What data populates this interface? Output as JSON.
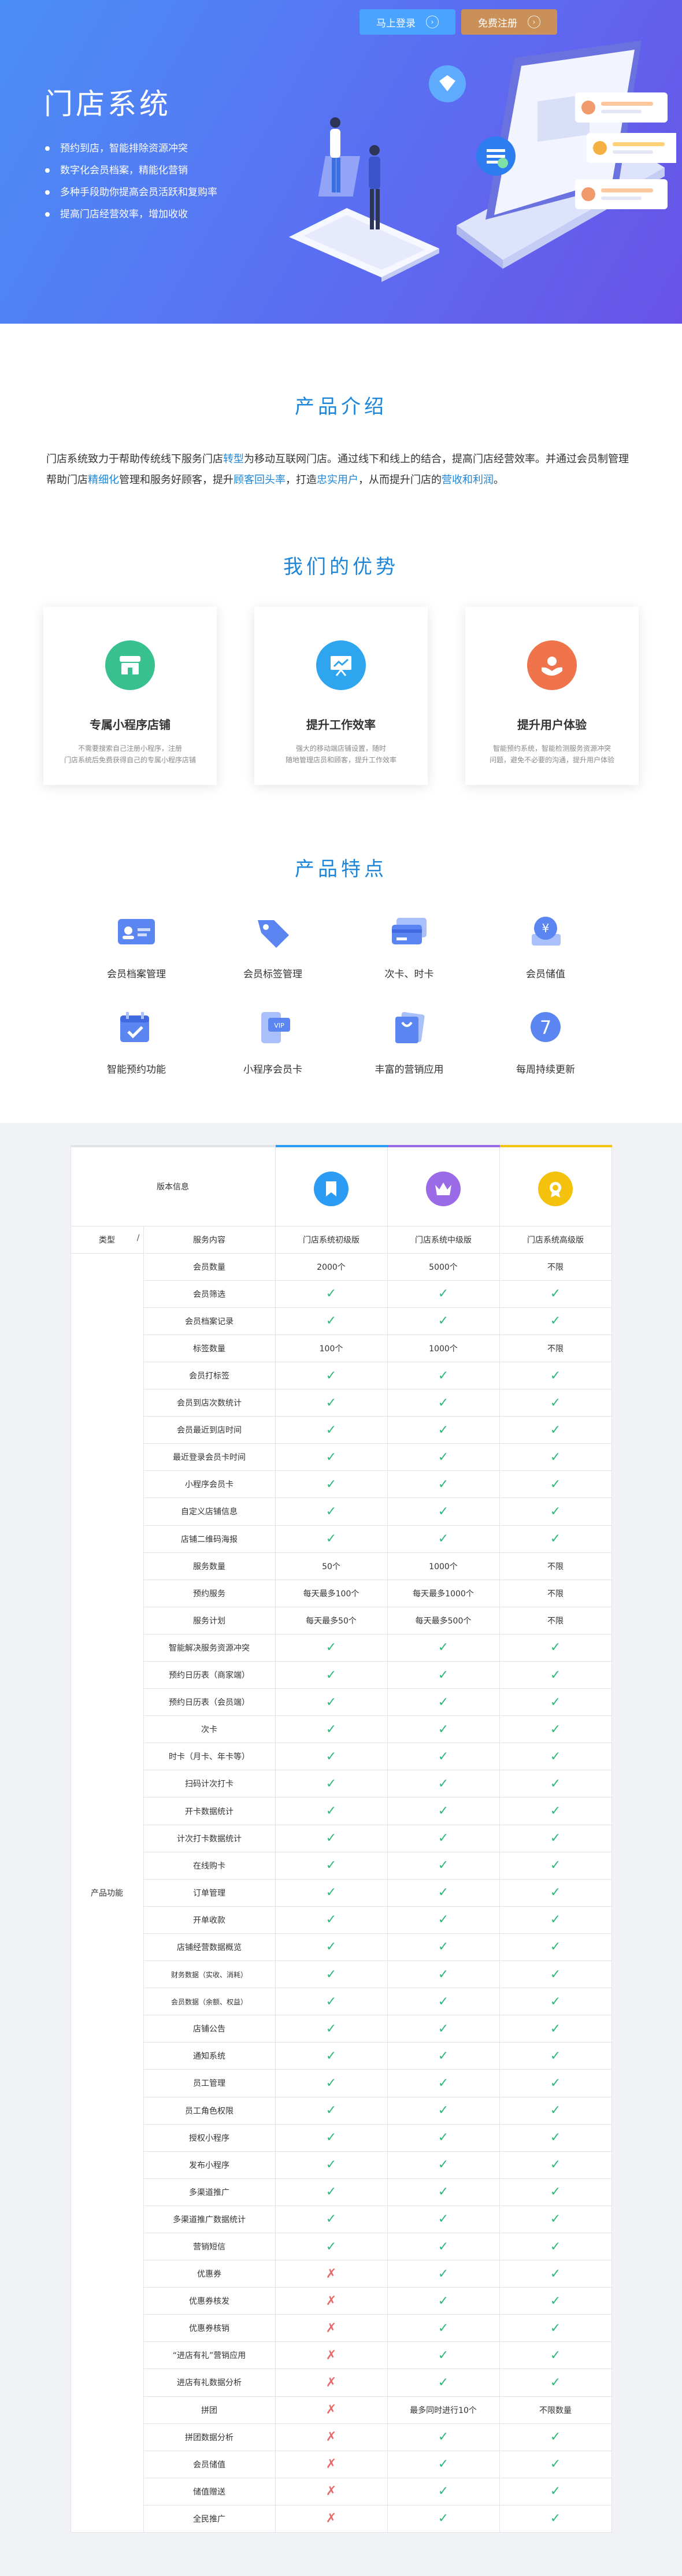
{
  "header": {
    "login_label": "马上登录",
    "register_label": "免费注册"
  },
  "hero": {
    "title": "门店系统",
    "bullets": [
      "预约到店，智能排除资源冲突",
      "数字化会员档案，精能化营销",
      "多种手段助你提高会员活跃和复购率",
      "提高门店经营效率，增加收收"
    ]
  },
  "intro": {
    "title": "产品介绍",
    "parts": [
      "门店系统致力于帮助传统线下服务门店",
      "转型",
      "为移动互联网门店。通过线下和线上的结合，提高门店经营效率。并通过会员制管理帮助门店",
      "精细化",
      "管理和服务好顾客，提升",
      "顾客回头率",
      "，打造",
      "忠实用户",
      "，从而提升门店的",
      "营收和利润",
      "。"
    ]
  },
  "advantages": {
    "title": "我们的优势",
    "cards": [
      {
        "title": "专属小程序店铺",
        "line1": "不需要搜索自己注册小程序，注册",
        "line2": "门店系统后免费获得自己的专属小程序店铺",
        "color": "#39c08f"
      },
      {
        "title": "提升工作效率",
        "line1": "强大的移动端店铺设置，随时",
        "line2": "随地管理店员和顾客，提升工作效率",
        "color": "#2fa5ef"
      },
      {
        "title": "提升用户体验",
        "line1": "智能预约系统，智能检测服务资源冲突",
        "line2": "问题，避免不必要的沟通，提升用户体验",
        "color": "#f0744b"
      }
    ]
  },
  "features": {
    "title": "产品特点",
    "items": [
      "会员档案管理",
      "会员标签管理",
      "次卡、时卡",
      "会员储值",
      "智能预约功能",
      "小程序会员卡",
      "丰富的营销应用",
      "每周持续更新"
    ]
  },
  "table": {
    "header": {
      "version_label": "版本信息",
      "type_label": "类型",
      "slash": "/",
      "service_label": "服务内容",
      "category": "产品功能"
    },
    "tiers": [
      {
        "name": "门店系统初级版",
        "color": "#2b9bf4"
      },
      {
        "name": "门店系统中级版",
        "color": "#9b6ae6"
      },
      {
        "name": "门店系统高级版",
        "color": "#f4c20d"
      }
    ],
    "rows": [
      {
        "name": "会员数量",
        "v": [
          "2000个",
          "5000个",
          "不限"
        ]
      },
      {
        "name": "会员筛选",
        "v": [
          "✓",
          "✓",
          "✓"
        ]
      },
      {
        "name": "会员档案记录",
        "v": [
          "✓",
          "✓",
          "✓"
        ]
      },
      {
        "name": "标签数量",
        "v": [
          "100个",
          "1000个",
          "不限"
        ]
      },
      {
        "name": "会员打标签",
        "v": [
          "✓",
          "✓",
          "✓"
        ]
      },
      {
        "name": "会员到店次数统计",
        "v": [
          "✓",
          "✓",
          "✓"
        ]
      },
      {
        "name": "会员最近到店时间",
        "v": [
          "✓",
          "✓",
          "✓"
        ]
      },
      {
        "name": "最近登录会员卡时间",
        "v": [
          "✓",
          "✓",
          "✓"
        ]
      },
      {
        "name": "小程序会员卡",
        "v": [
          "✓",
          "✓",
          "✓"
        ]
      },
      {
        "name": "自定义店铺信息",
        "v": [
          "✓",
          "✓",
          "✓"
        ]
      },
      {
        "name": "店铺二维码海报",
        "v": [
          "✓",
          "✓",
          "✓"
        ]
      },
      {
        "name": "服务数量",
        "v": [
          "50个",
          "1000个",
          "不限"
        ]
      },
      {
        "name": "预约服务",
        "v": [
          "每天最多100个",
          "每天最多1000个",
          "不限"
        ]
      },
      {
        "name": "服务计划",
        "v": [
          "每天最多50个",
          "每天最多500个",
          "不限"
        ]
      },
      {
        "name": "智能解决服务资源冲突",
        "v": [
          "✓",
          "✓",
          "✓"
        ]
      },
      {
        "name": "预约日历表（商家端）",
        "v": [
          "✓",
          "✓",
          "✓"
        ]
      },
      {
        "name": "预约日历表（会员端）",
        "v": [
          "✓",
          "✓",
          "✓"
        ]
      },
      {
        "name": "次卡",
        "v": [
          "✓",
          "✓",
          "✓"
        ]
      },
      {
        "name": "时卡（月卡、年卡等）",
        "v": [
          "✓",
          "✓",
          "✓"
        ]
      },
      {
        "name": "扫码计次打卡",
        "v": [
          "✓",
          "✓",
          "✓"
        ]
      },
      {
        "name": "开卡数据统计",
        "v": [
          "✓",
          "✓",
          "✓"
        ]
      },
      {
        "name": "计次打卡数据统计",
        "v": [
          "✓",
          "✓",
          "✓"
        ]
      },
      {
        "name": "在线购卡",
        "v": [
          "✓",
          "✓",
          "✓"
        ]
      },
      {
        "name": "订单管理",
        "v": [
          "✓",
          "✓",
          "✓"
        ]
      },
      {
        "name": "开单收款",
        "v": [
          "✓",
          "✓",
          "✓"
        ]
      },
      {
        "name": "店铺经营数据概览",
        "v": [
          "✓",
          "✓",
          "✓"
        ]
      },
      {
        "name": "财务数据（实收、消耗）",
        "v": [
          "✓",
          "✓",
          "✓"
        ],
        "small": true
      },
      {
        "name": "会员数据（余额、权益）",
        "v": [
          "✓",
          "✓",
          "✓"
        ],
        "small": true
      },
      {
        "name": "店铺公告",
        "v": [
          "✓",
          "✓",
          "✓"
        ]
      },
      {
        "name": "通知系统",
        "v": [
          "✓",
          "✓",
          "✓"
        ]
      },
      {
        "name": "员工管理",
        "v": [
          "✓",
          "✓",
          "✓"
        ]
      },
      {
        "name": "员工角色权限",
        "v": [
          "✓",
          "✓",
          "✓"
        ]
      },
      {
        "name": "授权小程序",
        "v": [
          "✓",
          "✓",
          "✓"
        ]
      },
      {
        "name": "发布小程序",
        "v": [
          "✓",
          "✓",
          "✓"
        ]
      },
      {
        "name": "多渠道推广",
        "v": [
          "✓",
          "✓",
          "✓"
        ]
      },
      {
        "name": "多渠道推广数据统计",
        "v": [
          "✓",
          "✓",
          "✓"
        ]
      },
      {
        "name": "营销短信",
        "v": [
          "✓",
          "✓",
          "✓"
        ]
      },
      {
        "name": "优惠券",
        "v": [
          "✗",
          "✓",
          "✓"
        ]
      },
      {
        "name": "优惠券核发",
        "v": [
          "✗",
          "✓",
          "✓"
        ]
      },
      {
        "name": "优惠券核销",
        "v": [
          "✗",
          "✓",
          "✓"
        ]
      },
      {
        "name": "“进店有礼”营销应用",
        "v": [
          "✗",
          "✓",
          "✓"
        ]
      },
      {
        "name": "进店有礼数据分析",
        "v": [
          "✗",
          "✓",
          "✓"
        ]
      },
      {
        "name": "拼团",
        "v": [
          "✗",
          "最多同时进行10个",
          "不限数量"
        ]
      },
      {
        "name": "拼团数据分析",
        "v": [
          "✗",
          "✓",
          "✓"
        ]
      },
      {
        "name": "会员储值",
        "v": [
          "✗",
          "✓",
          "✓"
        ]
      },
      {
        "name": "储值赠送",
        "v": [
          "✗",
          "✓",
          "✓"
        ]
      },
      {
        "name": "全民推广",
        "v": [
          "✗",
          "✓",
          "✓"
        ]
      }
    ]
  }
}
